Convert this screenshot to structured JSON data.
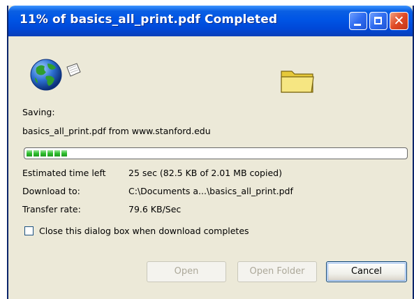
{
  "window": {
    "title": "11% of basics_all_print.pdf Completed"
  },
  "body": {
    "saving_label": "Saving:",
    "file_source": "basics_all_print.pdf from www.stanford.edu",
    "progress_fraction": 0.11,
    "details": [
      {
        "label": "Estimated time left",
        "value": "25 sec (82.5 KB of 2.01 MB copied)"
      },
      {
        "label": "Download to:",
        "value": "C:\\Documents a...\\basics_all_print.pdf"
      },
      {
        "label": "Transfer rate:",
        "value": "79.6 KB/Sec"
      }
    ],
    "close_checkbox_label": "Close this dialog box when download completes",
    "close_checkbox_checked": false
  },
  "buttons": {
    "open": "Open",
    "open_folder": "Open Folder",
    "cancel": "Cancel"
  },
  "icons": {
    "globe": "globe-icon",
    "paper": "flying-document-icon",
    "folder": "folder-icon"
  },
  "colors": {
    "titlebar": "#0055e5",
    "dialog_bg": "#ece9d8",
    "progress": "#2fbf2f"
  }
}
